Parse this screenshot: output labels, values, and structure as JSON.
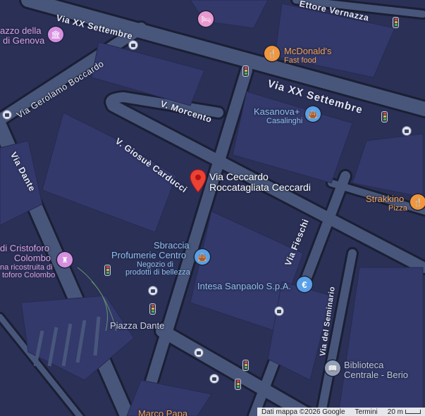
{
  "streets": {
    "via_xx_settembre_top": "Via XX Settembre",
    "via_xx_settembre_right": "Via XX Settembre",
    "ettore_vernazza": "Ettore Vernazza",
    "via_gerolamo_boccardo": "Via Gerolamo Boccardo",
    "v_morcento": "V. Morcento",
    "v_giosue_carducci": "V. Giosuè Carducci",
    "via_dante": "Via Dante",
    "via_fieschi": "Via Fieschi",
    "via_del_seminario": "Via del Seminario",
    "piazza_dante": "Piazza Dante"
  },
  "pois": {
    "palazzo": {
      "line1": "azzo della",
      "line2": "di Genova",
      "icon": "museum-icon",
      "color": "#d58fe0"
    },
    "mcdonalds": {
      "name": "McDonald's",
      "sub": "Fast food",
      "icon": "restaurant-icon",
      "color": "#f0963c"
    },
    "kasanova": {
      "name": "Kasanova+",
      "sub": "Casalinghi",
      "icon": "shopping-bag-icon",
      "color": "#5aa0e8"
    },
    "strakkino": {
      "name": "Strakkino",
      "sub": "Pizza",
      "icon": "restaurant-icon",
      "color": "#f0963c"
    },
    "sbraccia": {
      "line1": "Sbraccia",
      "line2": "Profumerie Centro",
      "sub1": "Negozio di",
      "sub2": "prodotti di bellezza",
      "icon": "shopping-bag-icon",
      "color": "#5aa0e8"
    },
    "intesa": {
      "name": "Intesa Sanpaolo S.p.A.",
      "icon": "euro-icon",
      "color": "#5aa0e8"
    },
    "casa_colombo": {
      "line1": "di Cristoforo",
      "line2": "Colombo",
      "sub1": "na ricostruita di",
      "sub2": "toforo Colombo",
      "icon": "monument-icon",
      "color": "#d58fe0"
    },
    "biblioteca": {
      "line1": "Biblioteca",
      "line2": "Centrale - Berio",
      "icon": "book-icon",
      "color": "#8fa0b8"
    },
    "marco_papa": {
      "name": "Marco Papa"
    },
    "hotel": {
      "icon": "hotel-icon",
      "color": "#e89ad0"
    }
  },
  "selected_place": {
    "line1": "Via Ceccardo",
    "line2": "Roccatagliata Ceccardi",
    "icon": "location-pin-icon",
    "color": "#ea4335"
  },
  "footer": {
    "attribution": "Dati mappa ©2026 Google",
    "terms": "Termini",
    "scale": "20 m"
  }
}
